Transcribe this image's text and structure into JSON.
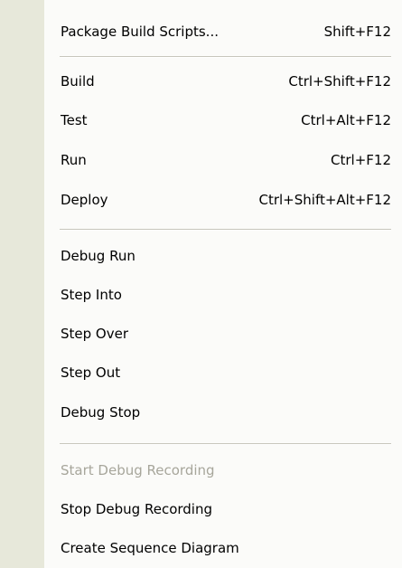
{
  "menu": {
    "items": [
      {
        "label": "Package Build Scripts...",
        "shortcut": "Shift+F12",
        "enabled": true
      },
      {
        "label": "Build",
        "shortcut": "Ctrl+Shift+F12",
        "enabled": true
      },
      {
        "label": "Test",
        "shortcut": "Ctrl+Alt+F12",
        "enabled": true
      },
      {
        "label": "Run",
        "shortcut": "Ctrl+F12",
        "enabled": true
      },
      {
        "label": "Deploy",
        "shortcut": "Ctrl+Shift+Alt+F12",
        "enabled": true
      },
      {
        "label": "Debug Run",
        "shortcut": "",
        "enabled": true
      },
      {
        "label": "Step Into",
        "shortcut": "",
        "enabled": true
      },
      {
        "label": "Step Over",
        "shortcut": "",
        "enabled": true
      },
      {
        "label": "Step Out",
        "shortcut": "",
        "enabled": true
      },
      {
        "label": "Debug Stop",
        "shortcut": "",
        "enabled": true
      },
      {
        "label": "Start Debug Recording",
        "shortcut": "",
        "enabled": false
      },
      {
        "label": "Stop Debug Recording",
        "shortcut": "",
        "enabled": true
      },
      {
        "label": "Create Sequence Diagram",
        "shortcut": "",
        "enabled": true
      }
    ]
  },
  "colors": {
    "gutter": "#e7e8da",
    "background": "#fbfbf9",
    "disabled_text": "#a7a69b",
    "separator": "#c7c6bc"
  }
}
